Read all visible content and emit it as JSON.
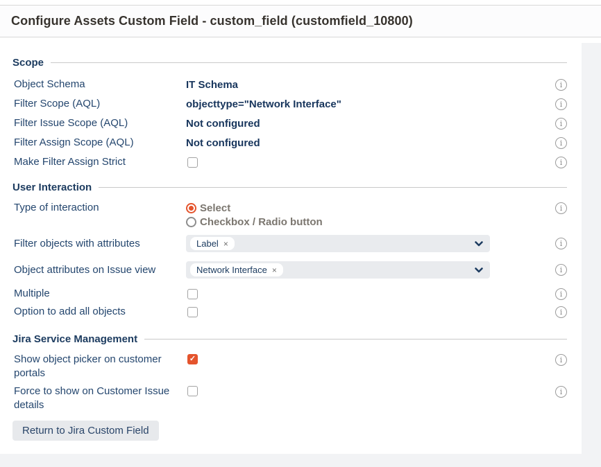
{
  "header": {
    "title": "Configure Assets Custom Field - custom_field (customfield_10800)"
  },
  "colors": {
    "accent_orange": "#e4542d",
    "label_navy": "#24466e",
    "value_navy": "#17355c",
    "section_navy": "#1d3c60",
    "chrome_gray": "#f2f3f5"
  },
  "icons": {
    "info": "i",
    "close": "×",
    "check": "✓"
  },
  "sections": {
    "scope": {
      "title": "Scope",
      "rows": [
        {
          "label": "Object Schema",
          "value": "IT Schema"
        },
        {
          "label": "Filter Scope (AQL)",
          "value": "objecttype=\"Network Interface\""
        },
        {
          "label": "Filter Issue Scope (AQL)",
          "value": "Not configured"
        },
        {
          "label": "Filter Assign Scope (AQL)",
          "value": "Not configured"
        },
        {
          "label": "Make Filter Assign Strict",
          "checkbox_checked": false
        }
      ]
    },
    "user_interaction": {
      "title": "User Interaction",
      "type_of_interaction": {
        "label": "Type of interaction",
        "options": [
          {
            "label": "Select",
            "selected": true
          },
          {
            "label": "Checkbox / Radio button",
            "selected": false
          }
        ]
      },
      "filter_attributes": {
        "label": "Filter objects with attributes",
        "tags": [
          {
            "text": "Label"
          }
        ]
      },
      "issue_view_attributes": {
        "label": "Object attributes on Issue view",
        "tags": [
          {
            "text": "Network Interface"
          }
        ]
      },
      "multiple": {
        "label": "Multiple",
        "checkbox_checked": false
      },
      "add_all": {
        "label": "Option to add all objects",
        "checkbox_checked": false
      }
    },
    "jsm": {
      "title": "Jira Service Management",
      "show_picker": {
        "label": "Show object picker on customer portals",
        "checkbox_checked": true
      },
      "force_show": {
        "label": "Force to show on Customer Issue details",
        "checkbox_checked": false
      }
    }
  },
  "footer": {
    "return_button_label": "Return to Jira Custom Field"
  }
}
